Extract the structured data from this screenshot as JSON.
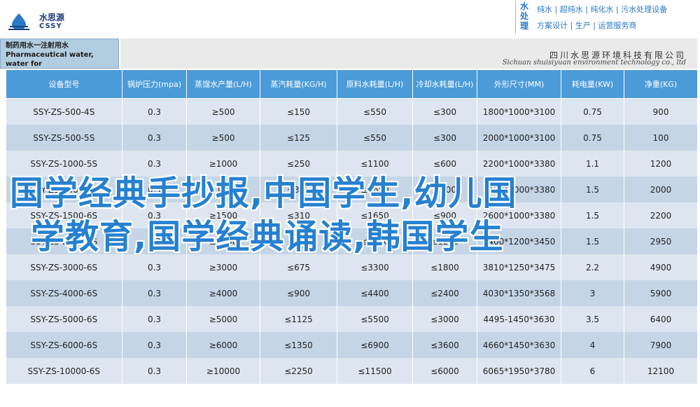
{
  "brand": {
    "cn": "水思源",
    "en": "CSSY"
  },
  "slogan": {
    "vertical": "水处理",
    "line1": "纯水 | 超纯水 | 纯化水 | 污水处理设备",
    "line2": "方案设计 | 生产 | 运营服务商"
  },
  "title": {
    "line1": "制药用水一注射用水",
    "line2": "Pharmaceutical water, water for",
    "line3": "injection"
  },
  "company": {
    "cn": "四川水思源环境科技有限公司",
    "en": "Sichuan shuisiyuan environment technology co., ltd"
  },
  "table": {
    "headers": [
      "设备型号",
      "锅炉压力(mpa)",
      "蒸馏水产量(L/H)",
      "蒸汽耗量(KG/H)",
      "原料水耗量(L/H)",
      "冷却水耗量(L/H)",
      "外形尺寸(MM)",
      "耗电量(KW)",
      "净重(KG)"
    ],
    "rows": [
      [
        "SSY-ZS-500-4S",
        "0.3",
        "≥500",
        "≤150",
        "≤550",
        "≤300",
        "1800*1000*3100",
        "0.75",
        "900"
      ],
      [
        "SSY-ZS-500-5S",
        "0.3",
        "≥500",
        "≤125",
        "≤550",
        "≤300",
        "2000*1000*3100",
        "0.75",
        "100"
      ],
      [
        "SSY-ZS-1000-5S",
        "0.3",
        "≥1000",
        "≤250",
        "≤1100",
        "≤600",
        "2200*1000*3380",
        "1.1",
        "1200"
      ],
      [
        "SSY-ZS-1500-5S",
        "0.3",
        "≥1500",
        "≤375",
        "≤1650",
        "≤900",
        "2450*1000*3380",
        "1.5",
        "2000"
      ],
      [
        "SSY-ZS-1500-6S",
        "0.3",
        "≥1500",
        "≤310",
        "≤1650",
        "≤900",
        "2600*1000*3380",
        "1.5",
        "2200"
      ],
      [
        "SSY-ZS-2000-6S",
        "0.3",
        "≥2000",
        "≤450",
        "≤2200",
        "≤1200",
        "3400*1200*3450",
        "1.5",
        "2950"
      ],
      [
        "SSY-ZS-3000-6S",
        "0.3",
        "≥3000",
        "≤675",
        "≤3300",
        "≤1800",
        "3810*1250*3475",
        "2.2",
        "4900"
      ],
      [
        "SSY-ZS-4000-6S",
        "0.3",
        "≥4000",
        "≤900",
        "≤4400",
        "≤2400",
        "4030*1350*3568",
        "3",
        "5900"
      ],
      [
        "SSY-ZS-5000-6S",
        "0.3",
        "≥5000",
        "≤1125",
        "≤5500",
        "≤3000",
        "4495-1450*3630",
        "3.5",
        "6400"
      ],
      [
        "SSY-ZS-6000-6S",
        "0.3",
        "≥6000",
        "≤1350",
        "≤6900",
        "≤3600",
        "4660*1450*3630",
        "4",
        "7900"
      ],
      [
        "SSY-ZS-10000-6S",
        "0.3",
        "≥10000",
        "≤2250",
        "≤11500",
        "≤6000",
        "6065*1950*3780",
        "6",
        "12100"
      ]
    ]
  },
  "overlay": {
    "line1": "国学经典手抄报,中国学生,幼儿国",
    "line2": "学教育,国学经典诵读,韩国学生"
  },
  "colors": {
    "header_blue": "#4b9bd9",
    "row_light": "#dde6f0",
    "row_dark": "#c5d5e6",
    "overlay_text": "#2680d0",
    "brand": "#1e3d7a"
  }
}
